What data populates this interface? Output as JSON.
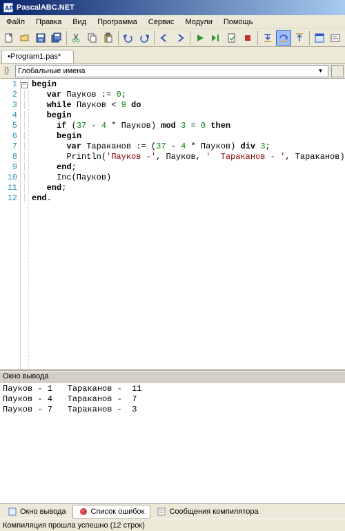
{
  "titlebar": {
    "text": "PascalABC.NET"
  },
  "menu": {
    "file": "Файл",
    "edit": "Правка",
    "view": "Вид",
    "program": "Программа",
    "service": "Сервис",
    "modules": "Модули",
    "help": "Помощь"
  },
  "tabs": {
    "active": "•Program1.pas*"
  },
  "scope": {
    "text": "Глобальные имена"
  },
  "code": {
    "lines": [
      {
        "n": "1",
        "fold": "box",
        "segs": [
          {
            "t": "begin",
            "c": "kw"
          }
        ]
      },
      {
        "n": "2",
        "fold": "",
        "segs": [
          {
            "t": "   ",
            "c": ""
          },
          {
            "t": "var",
            "c": "kw"
          },
          {
            "t": " Пауков := ",
            "c": ""
          },
          {
            "t": "0",
            "c": "num"
          },
          {
            "t": ";",
            "c": ""
          }
        ]
      },
      {
        "n": "3",
        "fold": "",
        "segs": [
          {
            "t": "   ",
            "c": ""
          },
          {
            "t": "while",
            "c": "kw"
          },
          {
            "t": " Пауков < ",
            "c": ""
          },
          {
            "t": "9",
            "c": "num"
          },
          {
            "t": " ",
            "c": ""
          },
          {
            "t": "do",
            "c": "kw"
          }
        ]
      },
      {
        "n": "4",
        "fold": "",
        "segs": [
          {
            "t": "   ",
            "c": ""
          },
          {
            "t": "begin",
            "c": "kw"
          }
        ]
      },
      {
        "n": "5",
        "fold": "",
        "segs": [
          {
            "t": "     ",
            "c": ""
          },
          {
            "t": "if",
            "c": "kw"
          },
          {
            "t": " (",
            "c": ""
          },
          {
            "t": "37",
            "c": "num"
          },
          {
            "t": " - ",
            "c": ""
          },
          {
            "t": "4",
            "c": "num"
          },
          {
            "t": " * Пауков) ",
            "c": ""
          },
          {
            "t": "mod",
            "c": "kw"
          },
          {
            "t": " ",
            "c": ""
          },
          {
            "t": "3",
            "c": "num"
          },
          {
            "t": " = ",
            "c": ""
          },
          {
            "t": "0",
            "c": "num"
          },
          {
            "t": " ",
            "c": ""
          },
          {
            "t": "then",
            "c": "kw"
          }
        ]
      },
      {
        "n": "6",
        "fold": "",
        "segs": [
          {
            "t": "     ",
            "c": ""
          },
          {
            "t": "begin",
            "c": "kw"
          }
        ]
      },
      {
        "n": "7",
        "fold": "",
        "segs": [
          {
            "t": "       ",
            "c": ""
          },
          {
            "t": "var",
            "c": "kw"
          },
          {
            "t": " Тараканов := (",
            "c": ""
          },
          {
            "t": "37",
            "c": "num"
          },
          {
            "t": " - ",
            "c": ""
          },
          {
            "t": "4",
            "c": "num"
          },
          {
            "t": " * Пауков) ",
            "c": ""
          },
          {
            "t": "div",
            "c": "kw"
          },
          {
            "t": " ",
            "c": ""
          },
          {
            "t": "3",
            "c": "num"
          },
          {
            "t": ";",
            "c": ""
          }
        ]
      },
      {
        "n": "8",
        "fold": "",
        "segs": [
          {
            "t": "       Println(",
            "c": ""
          },
          {
            "t": "'Пауков -'",
            "c": "str"
          },
          {
            "t": ", Пауков, ",
            "c": ""
          },
          {
            "t": "'  Тараканов - '",
            "c": "str"
          },
          {
            "t": ", Тараканов)",
            "c": ""
          }
        ]
      },
      {
        "n": "9",
        "fold": "",
        "segs": [
          {
            "t": "     ",
            "c": ""
          },
          {
            "t": "end",
            "c": "kw"
          },
          {
            "t": ";",
            "c": ""
          }
        ]
      },
      {
        "n": "10",
        "fold": "",
        "segs": [
          {
            "t": "     Inc(Пауков)",
            "c": ""
          }
        ]
      },
      {
        "n": "11",
        "fold": "",
        "segs": [
          {
            "t": "   ",
            "c": ""
          },
          {
            "t": "end",
            "c": "kw"
          },
          {
            "t": ";",
            "c": ""
          }
        ]
      },
      {
        "n": "12",
        "fold": "",
        "segs": [
          {
            "t": "",
            "c": ""
          },
          {
            "t": "end",
            "c": "kw"
          },
          {
            "t": ".",
            "c": ""
          }
        ]
      }
    ]
  },
  "output": {
    "header": "Окно вывода",
    "lines": [
      "Пауков - 1   Тараканов -  11",
      "Пауков - 4   Тараканов -  7",
      "Пауков - 7   Тараканов -  3"
    ]
  },
  "bottom_tabs": {
    "output": "Окно вывода",
    "errors": "Список ошибок",
    "compiler": "Сообщения компилятора"
  },
  "status": {
    "text": "Компиляция прошла успешно (12 строк)"
  }
}
